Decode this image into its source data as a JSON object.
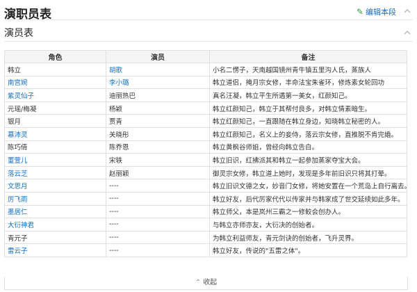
{
  "header": {
    "title": "演职员表",
    "edit_label": "编辑本段"
  },
  "section": {
    "title": "演员表"
  },
  "table": {
    "columns": [
      "角色",
      "演员",
      "备注"
    ],
    "rows": [
      {
        "role": "韩立",
        "role_link": false,
        "actor": "胡歌",
        "actor_link": true,
        "note": "小名二愣子，天南越国镜州青牛镇五里沟人氏，蒸族人"
      },
      {
        "role": "南宫婉",
        "role_link": true,
        "actor": "李小璐",
        "actor_link": true,
        "note": "韩立道侣，掩月宗女修，丰命法宝朱雀环，修炼素女轮回功"
      },
      {
        "role": "紫灵仙子",
        "role_link": true,
        "actor": "迪丽热巴",
        "actor_link": false,
        "note": "真名汪凝，韩立平生所遇第一美女，红颜知己。"
      },
      {
        "role": "元瑶/梅凝",
        "role_link": false,
        "actor": "杨颖",
        "actor_link": false,
        "note": "韩立红颜知己，韩立于其帮付良多，对韩立情素暗生。"
      },
      {
        "role": "银月",
        "role_link": false,
        "actor": "贾青",
        "actor_link": false,
        "note": "韩立红颜知己，一直跟随在韩立身边，知晓韩立秘密的人。"
      },
      {
        "role": "慕沛灵",
        "role_link": true,
        "actor": "关晓彤",
        "actor_link": false,
        "note": "韩立红颜知己，名义上的妾侍，落云宗女修，直推脱不肯完婚。"
      },
      {
        "role": "陈巧倩",
        "role_link": false,
        "actor": "陈乔恩",
        "actor_link": false,
        "note": "韩立黄枫谷师姐，曾经向韩立告白。"
      },
      {
        "role": "董萱儿",
        "role_link": true,
        "actor": "宋轶",
        "actor_link": false,
        "note": "韩立旧识，红拂派其和韩立一起参加蒸家夺宝大会。"
      },
      {
        "role": "落云芝",
        "role_link": true,
        "actor": "赵丽颖",
        "actor_link": false,
        "note": "御灵宗女修，韩立道上她时，发现是多年前旧识只将其打晕。"
      },
      {
        "role": "文思月",
        "role_link": true,
        "actor": "----",
        "actor_link": false,
        "note": "韩立旧识文德之女，妙音门女修，将她安置在一个荒岛上自行离去。"
      },
      {
        "role": "厉飞雨",
        "role_link": true,
        "actor": "----",
        "actor_link": false,
        "note": "韩立好友，后代厉家代代以传家并与韩家成了世交延续如此多年。"
      },
      {
        "role": "墨居仁",
        "role_link": true,
        "actor": "----",
        "actor_link": false,
        "note": "韩立师父，本是岚州三霸之一修鲛会创办人。"
      },
      {
        "role": "大衍神君",
        "role_link": true,
        "actor": "----",
        "actor_link": false,
        "note": "与韩立亦师亦友，大衍决的创始者。"
      },
      {
        "role": "青元子",
        "role_link": false,
        "actor": "----",
        "actor_link": false,
        "note": "为韩立利益师友，青元剑诀的创始者，飞升灵界。"
      },
      {
        "role": "雷云子",
        "role_link": true,
        "actor": "----",
        "actor_link": false,
        "note": "韩立好友，传说的\"五雷之体\"。"
      }
    ]
  },
  "footer": {
    "collapse_label": "收起"
  },
  "colors": {
    "link": "#136ec2",
    "edit_icon": "#3a9a3a"
  }
}
